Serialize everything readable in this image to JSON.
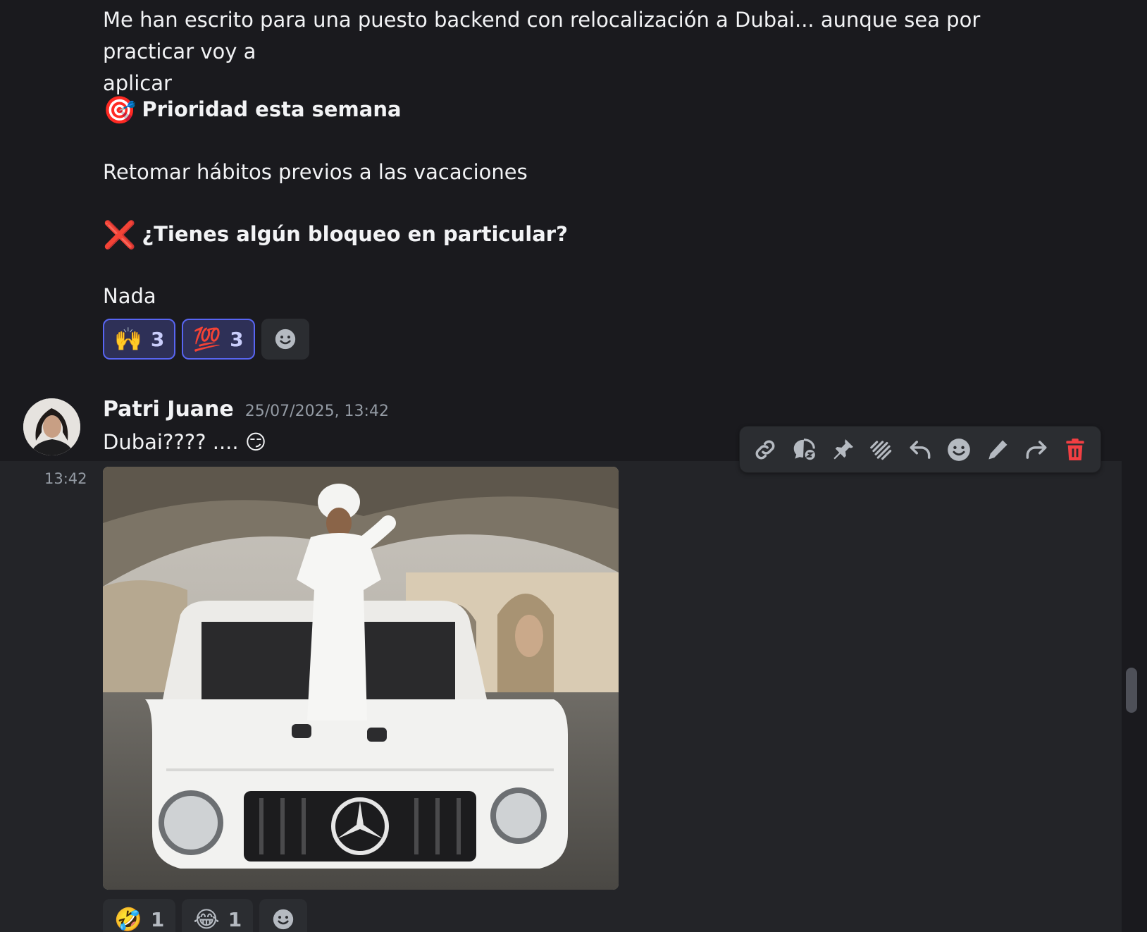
{
  "previous_message": {
    "line1": "Me han escrito para una puesto backend con relocalización a Dubai... aunque sea por practicar voy a",
    "line2": "aplicar",
    "priority_emoji": "🎯",
    "priority_heading": "Prioridad esta semana",
    "priority_text": "Retomar hábitos previos a las vacaciones",
    "blocker_emoji": "❌",
    "blocker_heading": "¿Tienes algún bloqueo en particular?",
    "blocker_text": "Nada",
    "reactions": [
      {
        "emoji": "🙌",
        "count": "3"
      },
      {
        "emoji": "💯",
        "count": "3"
      }
    ]
  },
  "message": {
    "author": "Patri Juane",
    "timestamp": "25/07/2025, 13:42",
    "text": "Dubai???? .... 😏",
    "side_time": "13:42",
    "reactions": [
      {
        "emoji": "🤣",
        "count": "1"
      },
      {
        "emoji": "😂",
        "count": "1"
      }
    ]
  },
  "toolbar": {
    "icons": [
      "link-icon",
      "thread-icon",
      "pin-icon",
      "apps-icon",
      "reply-icon",
      "emoji-icon",
      "edit-icon",
      "forward-icon",
      "delete-icon"
    ]
  },
  "colors": {
    "background": "#1a1a1e",
    "hover_background": "#232428",
    "reaction_active_border": "#5865f2",
    "delete_red": "#f23f43"
  }
}
